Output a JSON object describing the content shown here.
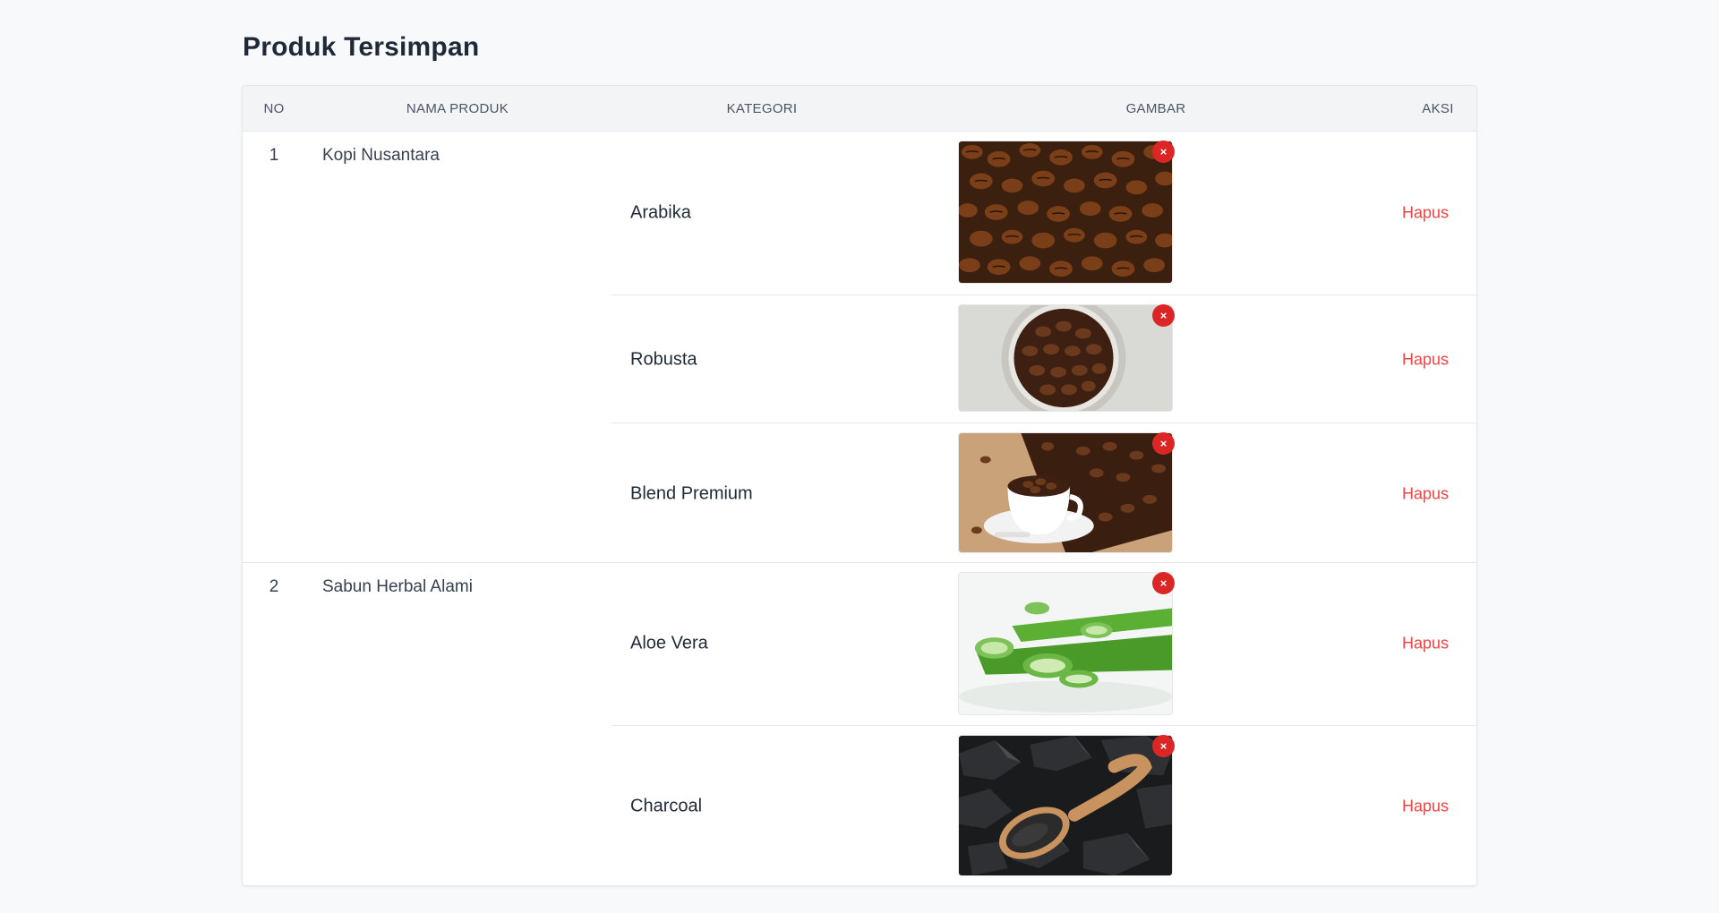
{
  "page": {
    "title": "Produk Tersimpan"
  },
  "table": {
    "headers": {
      "no": "NO",
      "nama": "NAMA PRODUK",
      "kategori": "KATEGORI",
      "gambar": "GAMBAR",
      "aksi": "AKSI"
    },
    "products": [
      {
        "no": "1",
        "nama": "Kopi Nusantara",
        "variants": [
          {
            "kategori": "Arabika",
            "image": "coffee-beans-image",
            "remove": "×",
            "action": "Hapus"
          },
          {
            "kategori": "Robusta",
            "image": "coffee-beans-bowl-image",
            "remove": "×",
            "action": "Hapus"
          },
          {
            "kategori": "Blend Premium",
            "image": "coffee-cup-beans-image",
            "remove": "×",
            "action": "Hapus"
          }
        ]
      },
      {
        "no": "2",
        "nama": "Sabun Herbal Alami",
        "variants": [
          {
            "kategori": "Aloe Vera",
            "image": "aloe-vera-image",
            "remove": "×",
            "action": "Hapus"
          },
          {
            "kategori": "Charcoal",
            "image": "charcoal-spoon-image",
            "remove": "×",
            "action": "Hapus"
          }
        ]
      }
    ]
  },
  "colors": {
    "accent_danger": "#dc2626",
    "link_danger": "#ef4444",
    "header_bg": "#f3f4f6"
  }
}
